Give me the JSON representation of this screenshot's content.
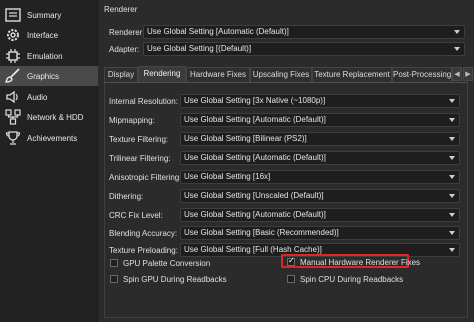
{
  "sidebar": {
    "items": [
      {
        "label": "Summary",
        "icon": "summary-icon"
      },
      {
        "label": "Interface",
        "icon": "interface-gear-icon"
      },
      {
        "label": "Emulation",
        "icon": "chip-icon"
      },
      {
        "label": "Graphics",
        "icon": "brush-icon",
        "selected": true
      },
      {
        "label": "Audio",
        "icon": "speaker-icon"
      },
      {
        "label": "Network & HDD",
        "icon": "network-icon"
      },
      {
        "label": "Achievements",
        "icon": "trophy-icon"
      }
    ]
  },
  "renderer": {
    "section_title": "Renderer",
    "renderer_label": "Renderer:",
    "renderer_value": "Use Global Setting [Automatic (Default)]",
    "adapter_label": "Adapter:",
    "adapter_value": "Use Global Setting [(Default)]"
  },
  "tabs": [
    {
      "label": "Display"
    },
    {
      "label": "Rendering",
      "active": true
    },
    {
      "label": "Hardware Fixes"
    },
    {
      "label": "Upscaling Fixes"
    },
    {
      "label": "Texture Replacement"
    },
    {
      "label": "Post-Processing"
    }
  ],
  "tab_scroll": {
    "left": "◀",
    "right": "▶"
  },
  "settings": [
    {
      "label": "Internal Resolution:",
      "value": "Use Global Setting [3x Native (~1080p)]"
    },
    {
      "label": "Mipmapping:",
      "value": "Use Global Setting [Automatic (Default)]"
    },
    {
      "label": "Texture Filtering:",
      "value": "Use Global Setting [Bilinear (PS2)]"
    },
    {
      "label": "Trilinear Filtering:",
      "value": "Use Global Setting [Automatic (Default)]"
    },
    {
      "label": "Anisotropic Filtering:",
      "value": "Use Global Setting [16x]"
    },
    {
      "label": "Dithering:",
      "value": "Use Global Setting [Unscaled (Default)]"
    },
    {
      "label": "CRC Fix Level:",
      "value": "Use Global Setting [Automatic (Default)]"
    },
    {
      "label": "Blending Accuracy:",
      "value": "Use Global Setting [Basic (Recommended)]"
    },
    {
      "label": "Texture Preloading:",
      "value": "Use Global Setting [Full (Hash Cache)]"
    }
  ],
  "checkboxes": [
    {
      "label": "GPU Palette Conversion",
      "checked": false
    },
    {
      "label": "Manual Hardware Renderer Fixes",
      "checked": true,
      "highlight_color": "#e0242a"
    },
    {
      "label": "Spin GPU During Readbacks",
      "checked": false
    },
    {
      "label": "Spin CPU During Readbacks",
      "checked": false
    }
  ],
  "colors": {
    "background": "#2b2b2b",
    "sidebar": "#222222",
    "selected_item": "#4a4a4a",
    "highlight": "#e0242a"
  }
}
